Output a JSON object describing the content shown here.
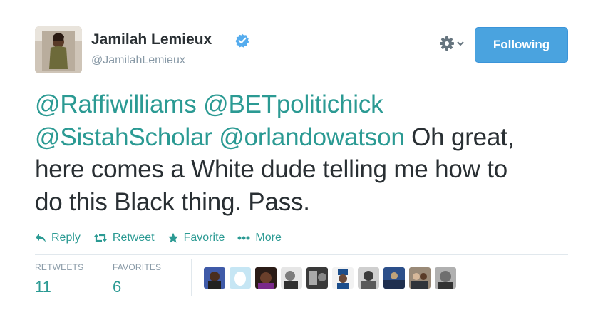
{
  "profile": {
    "name": "Jamilah Lemieux",
    "handle": "@JamilahLemieux",
    "avatar_icon": "profile-photo",
    "verified_icon": "verified-badge-icon"
  },
  "header": {
    "settings_icon": "gear-icon",
    "follow_label": "Following"
  },
  "tweet": {
    "mentions_line1": [
      "@Raffiwilliams",
      "@BETpolitichick"
    ],
    "mention3": "@SistahScholar",
    "mention4": "@orlandowatson",
    "text_after": "Oh great,",
    "line3": "here comes a White dude telling me how to",
    "line4": "do this Black thing. Pass."
  },
  "actions": {
    "reply": "Reply",
    "retweet": "Retweet",
    "favorite": "Favorite",
    "more": "More"
  },
  "stats": {
    "retweets_label": "RETWEETS",
    "retweets_value": "11",
    "favorites_label": "FAVORITES",
    "favorites_value": "6"
  },
  "colors": {
    "link": "#2b9a93",
    "button": "#4aa3df",
    "verified": "#55acee",
    "muted": "#8899a6"
  }
}
